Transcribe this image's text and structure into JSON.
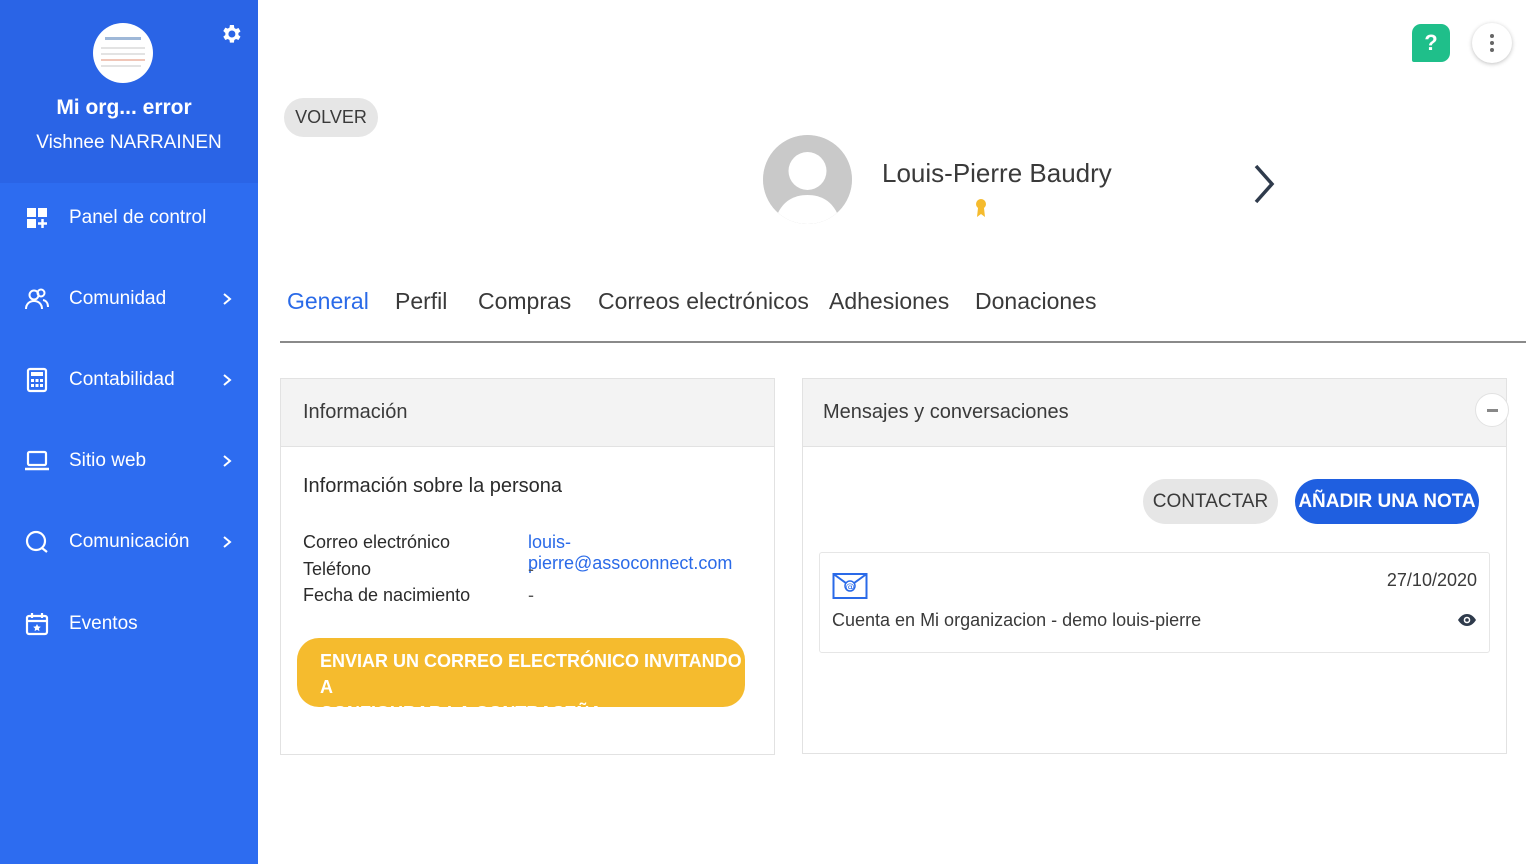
{
  "sidebar": {
    "org_name": "Mi org... error",
    "user_name": "Vishnee NARRAINEN",
    "settings_icon": "gear-icon",
    "items": [
      {
        "label": "Panel de control",
        "icon": "dashboard-icon",
        "has_children": false
      },
      {
        "label": "Comunidad",
        "icon": "community-icon",
        "has_children": true
      },
      {
        "label": "Contabilidad",
        "icon": "calculator-icon",
        "has_children": true
      },
      {
        "label": "Sitio web",
        "icon": "laptop-icon",
        "has_children": true
      },
      {
        "label": "Comunicación",
        "icon": "chat-icon",
        "has_children": true
      },
      {
        "label": "Eventos",
        "icon": "calendar-icon",
        "has_children": false
      }
    ]
  },
  "header": {
    "help_label": "?",
    "back_label": "VOLVER",
    "person_name": "Louis-Pierre Baudry"
  },
  "tabs": [
    {
      "label": "General",
      "active": true
    },
    {
      "label": "Perfil",
      "active": false
    },
    {
      "label": "Compras",
      "active": false
    },
    {
      "label": "Correos electrónicos",
      "active": false
    },
    {
      "label": "Adhesiones",
      "active": false
    },
    {
      "label": "Donaciones",
      "active": false
    }
  ],
  "info_card": {
    "title": "Información",
    "subtitle": "Información sobre la persona",
    "rows": [
      {
        "label": "Correo electrónico",
        "value": "louis-pierre@assoconnect.com"
      },
      {
        "label": "Teléfono",
        "value": "-"
      },
      {
        "label": "Fecha de nacimiento",
        "value": "-"
      }
    ],
    "invite_label_line1": "ENVIAR UN CORREO ELECTRÓNICO INVITANDO A",
    "invite_label_line2": "CONFIGURAR LA CONTRASEÑA"
  },
  "messages_card": {
    "title": "Mensajes y conversaciones",
    "contact_label": "CONTACTAR",
    "add_note_label": "AÑADIR UNA NOTA",
    "messages": [
      {
        "date": "27/10/2020",
        "text": "Cuenta en Mi organizacion - demo louis-pierre",
        "icon": "email-at-icon"
      }
    ]
  },
  "colors": {
    "sidebar": "#2d6cf0",
    "accent": "#2a6ae8",
    "invite": "#f5bb2e",
    "help": "#1fbf8a"
  }
}
